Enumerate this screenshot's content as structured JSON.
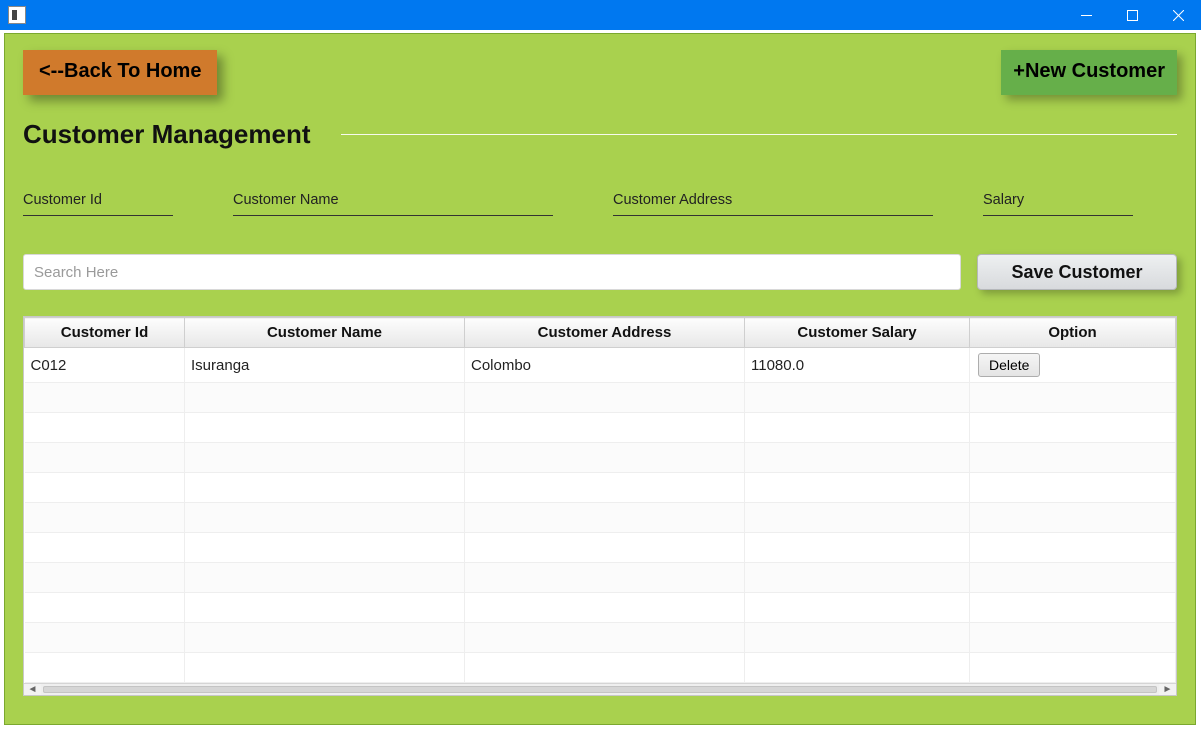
{
  "window": {
    "title": ""
  },
  "buttons": {
    "back": "<--Back To Home",
    "new": "+New Customer",
    "save": "Save Customer",
    "delete": "Delete"
  },
  "heading": "Customer Management",
  "fields": {
    "id_label": "Customer Id",
    "name_label": "Customer Name",
    "addr_label": "Customer Address",
    "sal_label": "Salary"
  },
  "search": {
    "placeholder": "Search Here",
    "value": ""
  },
  "table": {
    "headers": {
      "id": "Customer Id",
      "name": "Customer Name",
      "addr": "Customer Address",
      "sal": "Customer Salary",
      "opt": "Option"
    },
    "rows": [
      {
        "id": "C012",
        "name": "Isuranga",
        "addr": "Colombo",
        "sal": "11080.0"
      }
    ],
    "empty_row_count": 10
  }
}
